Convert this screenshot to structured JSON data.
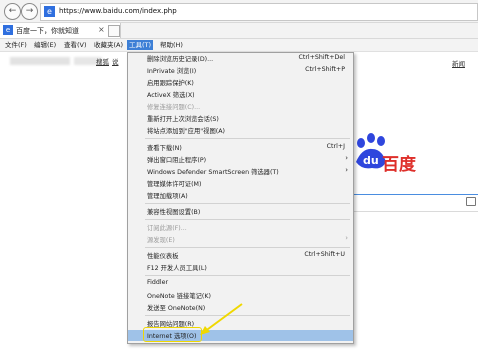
{
  "browser": {
    "url": "https://www.baidu.com/index.php",
    "tab_title": "百度一下，你就知道",
    "tab_close": "×"
  },
  "menubar": {
    "items": [
      "文件(F)",
      "编辑(E)",
      "查看(V)",
      "收藏夹(A)",
      "工具(T)",
      "帮助(H)"
    ],
    "active": "工具(T)"
  },
  "page": {
    "toplinks": [
      "搜狐",
      "说",
      "新闻"
    ],
    "logo_text": "百度",
    "logo_du": "du"
  },
  "tools_menu": {
    "items": [
      {
        "label": "删除浏览历史记录(D)...",
        "shortcut": "Ctrl+Shift+Del"
      },
      {
        "label": "InPrivate 浏览(I)",
        "shortcut": "Ctrl+Shift+P"
      },
      {
        "label": "启用跟踪保护(K)",
        "shortcut": ""
      },
      {
        "label": "ActiveX 筛选(X)",
        "shortcut": ""
      },
      {
        "label": "修复连接问题(C)...",
        "shortcut": "",
        "disabled": true
      },
      {
        "label": "重新打开上次浏览会话(S)",
        "shortcut": ""
      },
      {
        "label": "将站点添加到\"应用\"视图(A)",
        "shortcut": ""
      },
      {
        "label": "查看下载(N)",
        "shortcut": "Ctrl+J"
      },
      {
        "label": "弹出窗口阻止程序(P)",
        "shortcut": "",
        "submenu": true
      },
      {
        "label": "Windows Defender SmartScreen 筛选器(T)",
        "shortcut": "",
        "submenu": true
      },
      {
        "label": "管理媒体许可证(M)",
        "shortcut": ""
      },
      {
        "label": "管理加载项(A)",
        "shortcut": ""
      },
      {
        "label": "兼容性视图设置(B)",
        "shortcut": ""
      },
      {
        "label": "订阅此源(F)...",
        "shortcut": "",
        "disabled": true
      },
      {
        "label": "源发现(E)",
        "shortcut": "",
        "disabled": true,
        "submenu": true
      },
      {
        "label": "性能仪表板",
        "shortcut": "Ctrl+Shift+U"
      },
      {
        "label": "F12 开发人员工具(L)",
        "shortcut": ""
      },
      {
        "label": "Fiddler",
        "shortcut": ""
      },
      {
        "label": "OneNote 链接笔记(K)",
        "shortcut": ""
      },
      {
        "label": "发送至 OneNote(N)",
        "shortcut": ""
      },
      {
        "label": "报告网站问题(R)",
        "shortcut": ""
      },
      {
        "label": "Internet 选项(O)",
        "shortcut": "",
        "highlighted": true
      }
    ]
  },
  "colors": {
    "menu_active": "#3d7fd6",
    "highlight_row": "#9fc2e8",
    "annotation": "#f0d800",
    "baidu_red": "#de2f2a",
    "baidu_blue": "#2f46dd"
  },
  "icons": {
    "back": "back-arrow-icon",
    "forward": "forward-arrow-icon",
    "submenu": "chevron-right-icon"
  }
}
